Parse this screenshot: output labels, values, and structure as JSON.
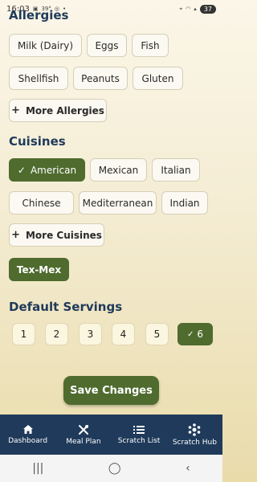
{
  "status": {
    "time": "16:03",
    "temp": "39°",
    "battery": "37"
  },
  "allergies": {
    "title": "Allergies",
    "items": [
      "Milk (Dairy)",
      "Eggs",
      "Fish",
      "Shellfish",
      "Peanuts",
      "Gluten"
    ],
    "more_label": "More Allergies"
  },
  "cuisines": {
    "title": "Cuisines",
    "items": [
      {
        "label": "American",
        "selected": true
      },
      {
        "label": "Mexican",
        "selected": false
      },
      {
        "label": "Italian",
        "selected": false
      },
      {
        "label": "Chinese",
        "selected": false
      },
      {
        "label": "Mediterranean",
        "selected": false
      },
      {
        "label": "Indian",
        "selected": false
      },
      {
        "label": "Tex-Mex",
        "selected": true
      }
    ],
    "more_label": "More Cuisines"
  },
  "servings": {
    "title": "Default Servings",
    "options": [
      "1",
      "2",
      "3",
      "4",
      "5",
      "6"
    ],
    "selected": "6"
  },
  "save_label": "Save Changes",
  "nav": [
    {
      "label": "Dashboard",
      "icon": "home-icon"
    },
    {
      "label": "Meal Plan",
      "icon": "utensils-icon"
    },
    {
      "label": "Scratch List",
      "icon": "list-icon"
    },
    {
      "label": "Scratch Hub",
      "icon": "hub-icon"
    }
  ],
  "colors": {
    "accent": "#4f6b2e",
    "nav_bg": "#1f3a5a",
    "heading": "#1f3a5a"
  }
}
